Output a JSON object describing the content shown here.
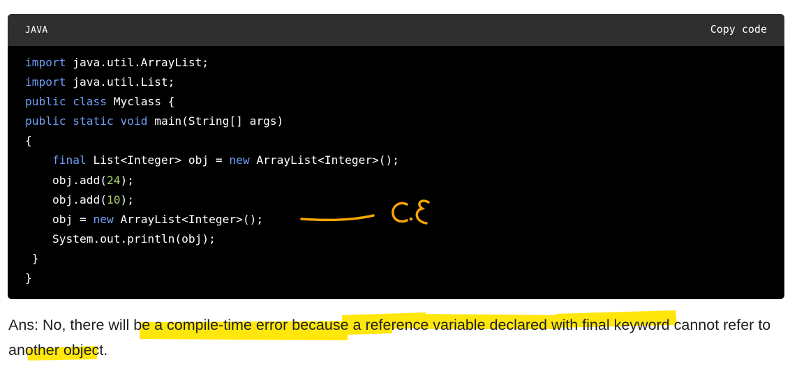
{
  "code_block": {
    "language": "JAVA",
    "copy_label": "Copy code",
    "lines": [
      [
        {
          "t": "import",
          "c": "kw"
        },
        {
          "t": " java.util.ArrayList;",
          "c": ""
        }
      ],
      [
        {
          "t": "import",
          "c": "kw"
        },
        {
          "t": " java.util.List;",
          "c": ""
        }
      ],
      [
        {
          "t": "public",
          "c": "kw"
        },
        {
          "t": " ",
          "c": ""
        },
        {
          "t": "class",
          "c": "kw"
        },
        {
          "t": " Myclass {",
          "c": ""
        }
      ],
      [
        {
          "t": "public",
          "c": "kw"
        },
        {
          "t": " ",
          "c": ""
        },
        {
          "t": "static",
          "c": "kw"
        },
        {
          "t": " ",
          "c": ""
        },
        {
          "t": "void",
          "c": "kw"
        },
        {
          "t": " main(String[] args)",
          "c": ""
        }
      ],
      [
        {
          "t": "{",
          "c": ""
        }
      ],
      [
        {
          "t": "    ",
          "c": ""
        },
        {
          "t": "final",
          "c": "kw"
        },
        {
          "t": " List<Integer> obj = ",
          "c": ""
        },
        {
          "t": "new",
          "c": "kw"
        },
        {
          "t": " ArrayList<Integer>();",
          "c": ""
        }
      ],
      [
        {
          "t": "    obj.add(",
          "c": ""
        },
        {
          "t": "24",
          "c": "num"
        },
        {
          "t": ");",
          "c": ""
        }
      ],
      [
        {
          "t": "    obj.add(",
          "c": ""
        },
        {
          "t": "10",
          "c": "num"
        },
        {
          "t": ");",
          "c": ""
        }
      ],
      [
        {
          "t": "    obj = ",
          "c": ""
        },
        {
          "t": "new",
          "c": "kw"
        },
        {
          "t": " ArrayList<Integer>();",
          "c": ""
        }
      ],
      [
        {
          "t": "    System.out.println(obj);",
          "c": ""
        }
      ],
      [
        {
          "t": " }",
          "c": ""
        }
      ],
      [
        {
          "t": "}",
          "c": ""
        }
      ]
    ]
  },
  "annotation": {
    "text": "C.E",
    "color": "#f5a500"
  },
  "highlight_color": "#ffe600",
  "answer": {
    "text": "Ans: No, there will be a compile-time error because a reference variable declared with final keyword cannot refer to another object."
  }
}
